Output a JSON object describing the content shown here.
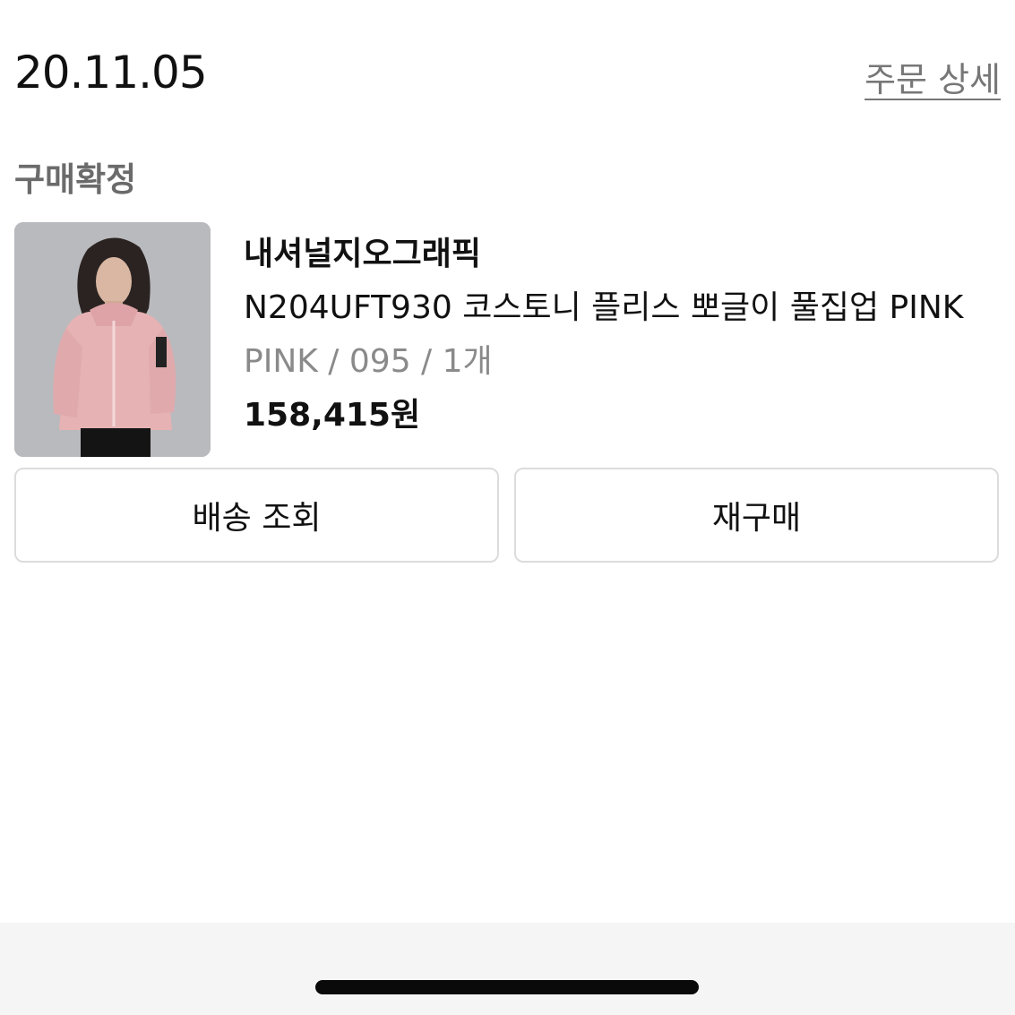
{
  "order": {
    "date": "20.11.05",
    "detail_link": "주문 상세",
    "status": "구매확정"
  },
  "product": {
    "image_icon": "product-photo",
    "brand": "내셔널지오그래픽",
    "name": "N204UFT930 코스토니 플리스 뽀글이 풀집업 PINK",
    "option": "PINK / 095 / 1개",
    "price": "158,415원"
  },
  "actions": {
    "track_delivery": "배송 조회",
    "reorder": "재구매"
  },
  "colors": {
    "text_primary": "#111111",
    "text_secondary": "#8a8a8a",
    "status_gray": "#6b6b6b",
    "button_border": "#dcdcdc",
    "bottom_bar": "#f5f5f5",
    "jacket_pink": "#e8b4b6"
  }
}
